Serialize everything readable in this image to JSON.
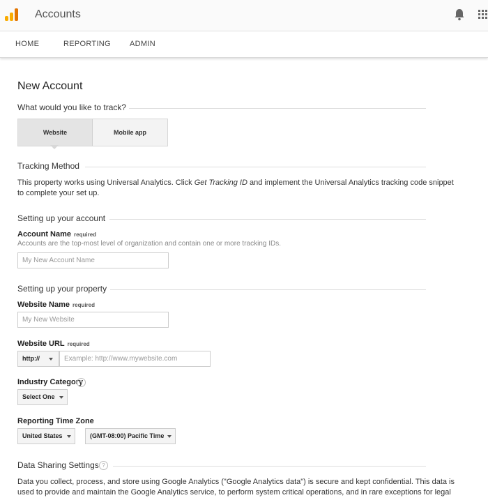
{
  "header": {
    "title": "Accounts",
    "logo": "analytics-logo",
    "icons": [
      "bell-icon",
      "apps-grid-icon"
    ]
  },
  "nav": {
    "items": [
      "HOME",
      "REPORTING",
      "ADMIN"
    ]
  },
  "page": {
    "title": "New Account"
  },
  "track": {
    "question": "What would you like to track?",
    "options": [
      "Website",
      "Mobile app"
    ],
    "selected": "Website"
  },
  "tracking": {
    "title": "Tracking Method",
    "text_before": "This property works using Universal Analytics. Click ",
    "link_text": "Get Tracking ID",
    "text_after": " and implement the Universal Analytics tracking code snippet",
    "text_line2": "to complete your set up."
  },
  "account": {
    "section_title": "Setting up your account",
    "name_label": "Account Name",
    "required": "required",
    "hint": "Accounts are the top-most level of organization and contain one or more tracking IDs.",
    "name_placeholder": "My New Account Name"
  },
  "property": {
    "section_title": "Setting up your property",
    "website_name_label": "Website Name",
    "website_name_placeholder": "My New Website",
    "url_label": "Website URL",
    "protocol": "http://",
    "url_placeholder": "Example: http://www.mywebsite.com",
    "industry_label": "Industry Category",
    "industry_value": "Select One",
    "timezone_label": "Reporting Time Zone",
    "country_value": "United States",
    "timezone_value": "(GMT-08:00) Pacific Time"
  },
  "sharing": {
    "title": "Data Sharing Settings",
    "line1": "Data you collect, process, and store using Google Analytics (\"Google Analytics data\") is secure and kept confidential. This data is",
    "line2": "used to provide and maintain the Google Analytics service, to perform system critical operations, and in rare exceptions for legal"
  },
  "colors": {
    "logo_dark": "#e37400",
    "logo_light": "#f9ab00",
    "text": "#222222"
  }
}
